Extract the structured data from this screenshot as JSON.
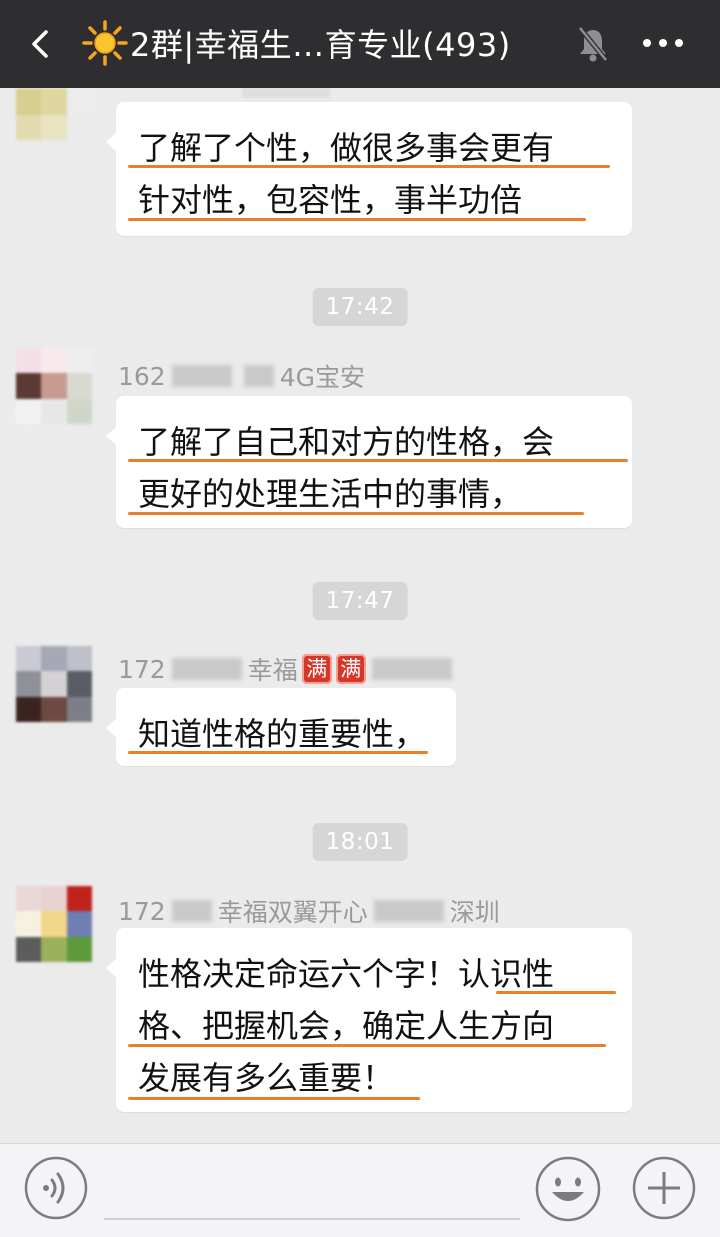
{
  "header": {
    "title": "2群|幸福生…育专业(493)",
    "icons": [
      "back-icon",
      "sun-icon",
      "mute-icon",
      "more-icon"
    ]
  },
  "messages": [
    {
      "sender": "",
      "lines": [
        "了解了个性，做很多事会更有",
        "针对性，包容性，事半功倍"
      ]
    },
    {
      "time": "17:42",
      "sender_prefix": "162",
      "sender_suffix": "4G宝安",
      "lines": [
        "了解了自己和对方的性格，会",
        "更好的处理生活中的事情，"
      ]
    },
    {
      "time": "17:47",
      "sender_prefix": "172",
      "sender_mid": "幸福",
      "sender_tag1": "满",
      "sender_tag2": "满",
      "lines": [
        "知道性格的重要性，"
      ]
    },
    {
      "time": "18:01",
      "sender_prefix": "172",
      "sender_mid": "幸福双翼开心",
      "sender_suffix": "深圳",
      "lines": [
        "性格决定命运六个字！认识性",
        "格、把握机会，确定人生方向",
        "发展有多么重要！"
      ]
    }
  ],
  "colors": {
    "header_bg": "#2e2e30",
    "chat_bg": "#ebebeb",
    "bubble_bg": "#ffffff",
    "underline": "#e87f2a",
    "timestamp_bg": "#d6d6d6",
    "tag_red": "#d7362a"
  },
  "input_bar": {
    "icons": [
      "voice-icon",
      "emoji-icon",
      "plus-icon"
    ]
  }
}
